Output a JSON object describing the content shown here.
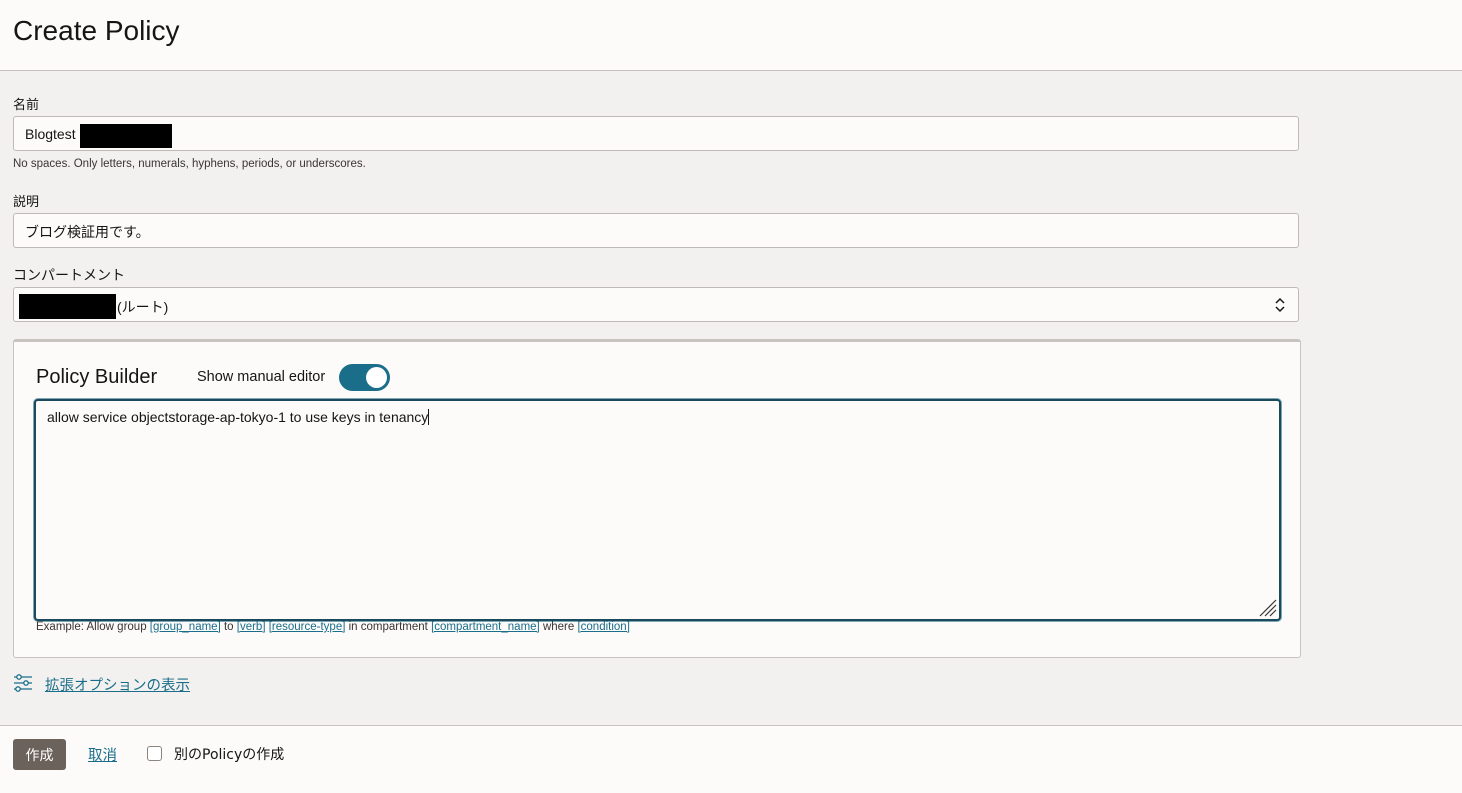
{
  "page": {
    "title": "Create Policy"
  },
  "form": {
    "name": {
      "label": "名前",
      "value": "Blogtest",
      "hint": "No spaces. Only letters, numerals, hyphens, periods, or underscores."
    },
    "description": {
      "label": "説明",
      "value": "ブログ検証用です。"
    },
    "compartment": {
      "label": "コンパートメント",
      "value_suffix": "(ルート)"
    }
  },
  "policy_builder": {
    "title": "Policy Builder",
    "toggle_label": "Show manual editor",
    "toggle_on": true,
    "editor_text": "allow service objectstorage-ap-tokyo-1 to use keys in tenancy",
    "example": {
      "prefix": "Example: Allow group ",
      "group_name": "[group_name]",
      "to": " to ",
      "verb": "[verb]",
      "resource_type": "[resource-type]",
      "in_compartment": " in compartment ",
      "compartment_name": "[compartment_name]",
      "where": " where ",
      "condition": "[condition]"
    }
  },
  "advanced": {
    "label": "拡張オプションの表示",
    "icon": "sliders-icon"
  },
  "footer": {
    "create_label": "作成",
    "cancel_label": "取消",
    "another_label": "別のPolicyの作成",
    "another_checked": false
  },
  "colors": {
    "accent": "#1b6e8a",
    "primary_button": "#6b625b",
    "background": "#f2f1ef"
  }
}
